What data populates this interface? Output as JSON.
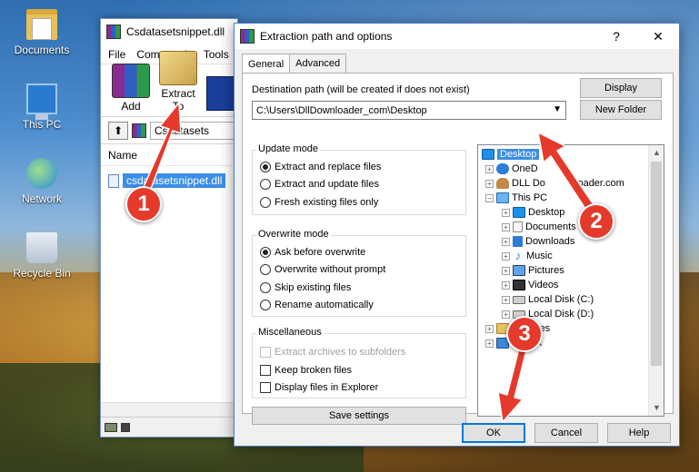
{
  "desktop": {
    "icons": [
      {
        "label": "Documents",
        "icon": "folder-documents-icon"
      },
      {
        "label": "This PC",
        "icon": "computer-icon"
      },
      {
        "label": "Network",
        "icon": "network-icon"
      },
      {
        "label": "Recycle Bin",
        "icon": "recycle-bin-icon"
      }
    ]
  },
  "main_window": {
    "title": "Csdatasetsnippet.dll",
    "menu": [
      "File",
      "Commands",
      "Tools"
    ],
    "toolbar": {
      "add": "Add",
      "extract_to": "Extract To"
    },
    "path": "Csdatasets",
    "column_name": "Name",
    "selected_file": "csdatasetsnippet.dll"
  },
  "dialog": {
    "title": "Extraction path and options",
    "help_btn": "?",
    "close_btn": "✕",
    "tabs": [
      "General",
      "Advanced"
    ],
    "destination_label": "Destination path (will be created if does not exist)",
    "destination_value": "C:\\Users\\DllDownloader_com\\Desktop",
    "display_btn": "Display",
    "new_folder_btn": "New Folder",
    "update_mode": {
      "title": "Update mode",
      "options": [
        "Extract and replace files",
        "Extract and update files",
        "Fresh existing files only"
      ],
      "selected": 0
    },
    "overwrite_mode": {
      "title": "Overwrite mode",
      "options": [
        "Ask before overwrite",
        "Overwrite without prompt",
        "Skip existing files",
        "Rename automatically"
      ],
      "selected": 0
    },
    "misc": {
      "title": "Miscellaneous",
      "options": [
        {
          "label": "Extract archives to subfolders",
          "disabled": true,
          "checked": false
        },
        {
          "label": "Keep broken files",
          "disabled": false,
          "checked": false
        },
        {
          "label": "Display files in Explorer",
          "disabled": false,
          "checked": false
        }
      ]
    },
    "save_settings": "Save settings",
    "tree": {
      "desktop": "Desktop",
      "onedrive": "OneD",
      "user": "DLL Do",
      "user_tail": "nloader.com",
      "thispc": "This PC",
      "desktop2": "Desktop",
      "documents": "Documents",
      "downloads": "Downloads",
      "music": "Music",
      "pictures": "Pictures",
      "videos": "Videos",
      "disk_c": "Local Disk (C:)",
      "disk_d": "Local Disk (D:)",
      "libraries": "Libraries",
      "network": "ork"
    },
    "ok": "OK",
    "cancel": "Cancel",
    "help": "Help"
  },
  "annotations": {
    "step1": "1",
    "step2": "2",
    "step3": "3",
    "color": "#e53a2b"
  }
}
